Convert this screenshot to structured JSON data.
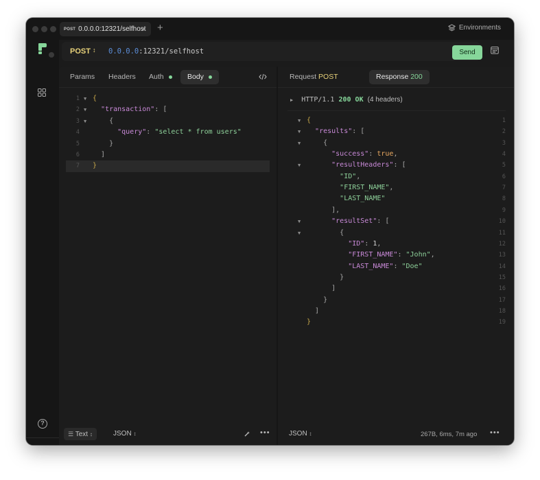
{
  "window_tab": {
    "method": "POST",
    "label": "0.0.0.0:12321/selfhost",
    "close": "×"
  },
  "new_tab": "+",
  "environments": {
    "label": "Environments",
    "icon": "layers-icon"
  },
  "request": {
    "method": "POST",
    "method_arrows": "↕",
    "url_host": "0.0.0.0",
    "url_rest": ":12321/selfhost",
    "send_label": "Send"
  },
  "request_tabs": [
    {
      "label": "Params"
    },
    {
      "label": "Headers"
    },
    {
      "label": "Auth"
    },
    {
      "label": "Body"
    }
  ],
  "body_lines": [
    {
      "n": "1",
      "fold": "▼",
      "html": "<span class='brace'>{</span>"
    },
    {
      "n": "2",
      "fold": "▼",
      "html": "  <span class='k'>\"transaction\"</span><span class='p'>: [</span>"
    },
    {
      "n": "3",
      "fold": "▼",
      "html": "    <span class='p'>{</span>"
    },
    {
      "n": "4",
      "fold": "",
      "html": "      <span class='k'>\"query\"</span><span class='p'>: </span><span class='s'>\"select * from users\"</span>"
    },
    {
      "n": "5",
      "fold": "",
      "html": "    <span class='p'>}</span>"
    },
    {
      "n": "6",
      "fold": "",
      "html": "  <span class='p'>]</span>"
    },
    {
      "n": "7",
      "fold": "",
      "html": "<span class='brace'>}</span>"
    }
  ],
  "response_tabs": {
    "request_label": "Request",
    "request_method": "POST",
    "response_label": "Response",
    "response_code": "200"
  },
  "status": {
    "arrow": "▶",
    "protocol": "HTTP/1.1",
    "code": "200 OK",
    "headers": "(4 headers)"
  },
  "response_lines": [
    {
      "n": "1",
      "fold": "▼",
      "html": "<span class='brace'>{</span>"
    },
    {
      "n": "2",
      "fold": "▼",
      "html": "  <span class='k'>\"results\"</span><span class='p'>: [</span>"
    },
    {
      "n": "3",
      "fold": "▼",
      "html": "    <span class='p'>{</span>"
    },
    {
      "n": "4",
      "fold": "",
      "html": "      <span class='k'>\"success\"</span><span class='p'>: </span><span class='b'>true</span><span class='p'>,</span>"
    },
    {
      "n": "5",
      "fold": "▼",
      "html": "      <span class='k'>\"resultHeaders\"</span><span class='p'>: [</span>"
    },
    {
      "n": "6",
      "fold": "",
      "html": "        <span class='s'>\"ID\"</span><span class='p'>,</span>"
    },
    {
      "n": "7",
      "fold": "",
      "html": "        <span class='s'>\"FIRST_NAME\"</span><span class='p'>,</span>"
    },
    {
      "n": "8",
      "fold": "",
      "html": "        <span class='s'>\"LAST_NAME\"</span>"
    },
    {
      "n": "9",
      "fold": "",
      "html": "      <span class='p'>],</span>"
    },
    {
      "n": "10",
      "fold": "▼",
      "html": "      <span class='k'>\"resultSet\"</span><span class='p'>: [</span>"
    },
    {
      "n": "11",
      "fold": "▼",
      "html": "        <span class='p'>{</span>"
    },
    {
      "n": "12",
      "fold": "",
      "html": "          <span class='k'>\"ID\"</span><span class='p'>: </span><span class='n'>1</span><span class='p'>,</span>"
    },
    {
      "n": "13",
      "fold": "",
      "html": "          <span class='k'>\"FIRST_NAME\"</span><span class='p'>: </span><span class='s'>\"John\"</span><span class='p'>,</span>"
    },
    {
      "n": "14",
      "fold": "",
      "html": "          <span class='k'>\"LAST_NAME\"</span><span class='p'>: </span><span class='s'>\"Doe\"</span>"
    },
    {
      "n": "15",
      "fold": "",
      "html": "        <span class='p'>}</span>"
    },
    {
      "n": "16",
      "fold": "",
      "html": "      <span class='p'>]</span>"
    },
    {
      "n": "17",
      "fold": "",
      "html": "    <span class='p'>}</span>"
    },
    {
      "n": "18",
      "fold": "",
      "html": "  <span class='p'>]</span>"
    },
    {
      "n": "19",
      "fold": "",
      "html": "<span class='brace'>}</span>"
    }
  ],
  "left_footer": {
    "text_mode": "Text",
    "format": "JSON"
  },
  "right_footer": {
    "format": "JSON",
    "meta": "267B, 6ms, 7m ago"
  },
  "help": "?",
  "more": "•••",
  "colors": {
    "accent_green": "#86d69a",
    "accent_yellow": "#e8d27a",
    "background": "#1b1b1b"
  }
}
